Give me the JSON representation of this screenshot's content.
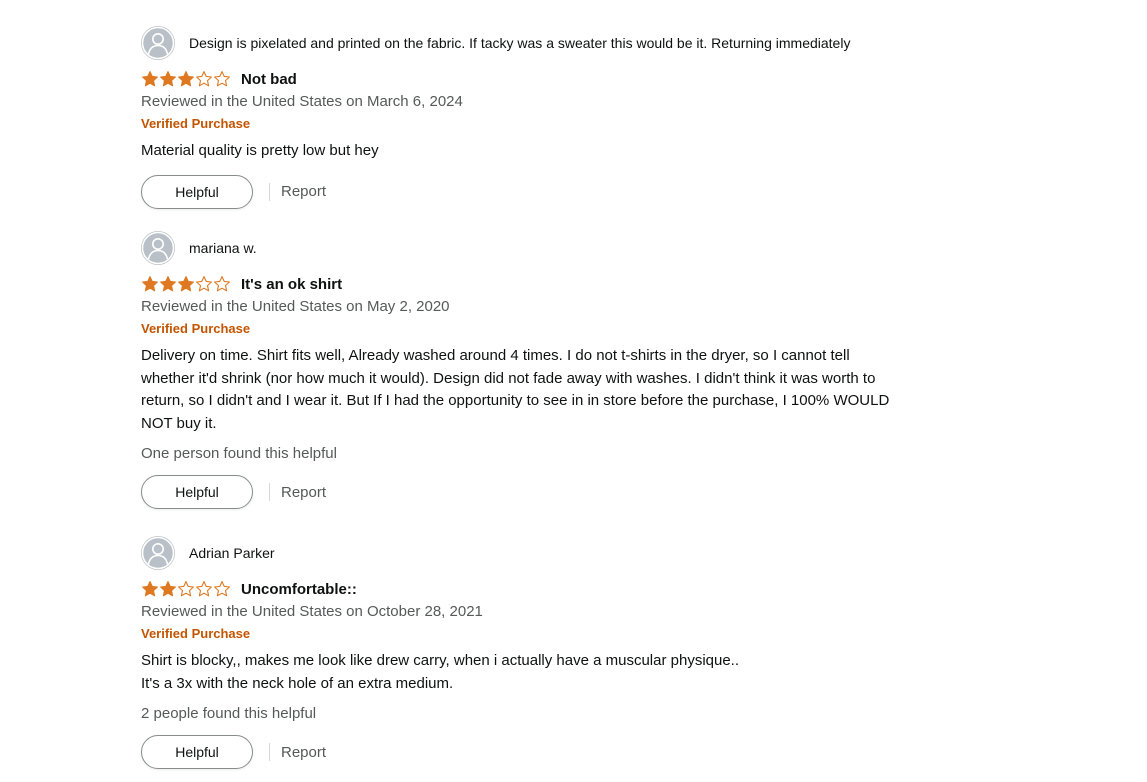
{
  "colors": {
    "star_fill": "#de7921",
    "verified": "#c45500",
    "muted_text": "#565959",
    "text": "#0f1111"
  },
  "icons": {
    "avatar": "default-profile-icon",
    "star": "star-icon"
  },
  "reviews": [
    {
      "profile_name": "Design is pixelated and printed on the fabric. If tacky was a sweater this would be it. Returning immediately",
      "rating": 3,
      "title": "Not bad",
      "date": "Reviewed in the United States on March 6, 2024",
      "verified": "Verified Purchase",
      "body": [
        "Material quality is pretty low but hey"
      ],
      "helpful_count": "",
      "helpful_label": "Helpful",
      "report_label": "Report"
    },
    {
      "profile_name": "mariana w.",
      "rating": 3,
      "title": "It's an ok shirt",
      "date": "Reviewed in the United States on May 2, 2020",
      "verified": "Verified Purchase",
      "body": [
        "Delivery on time. Shirt fits well, Already washed around 4 times. I do not t-shirts in the dryer, so I cannot tell whether it'd shrink (nor how much it would). Design did not fade away with washes. I didn't think it was worth to return, so I didn't and I wear it. But If I had the opportunity to see in in store before the purchase, I 100% WOULD NOT buy it."
      ],
      "helpful_count": "One person found this helpful",
      "helpful_label": "Helpful",
      "report_label": "Report"
    },
    {
      "profile_name": "Adrian Parker",
      "rating": 2,
      "title": "Uncomfortable::",
      "date": "Reviewed in the United States on October 28, 2021",
      "verified": "Verified Purchase",
      "body": [
        "Shirt is blocky,, makes me look like drew carry, when i actually have a muscular physique..",
        "It's a 3x with the neck hole of an extra medium."
      ],
      "helpful_count": "2 people found this helpful",
      "helpful_label": "Helpful",
      "report_label": "Report"
    }
  ]
}
